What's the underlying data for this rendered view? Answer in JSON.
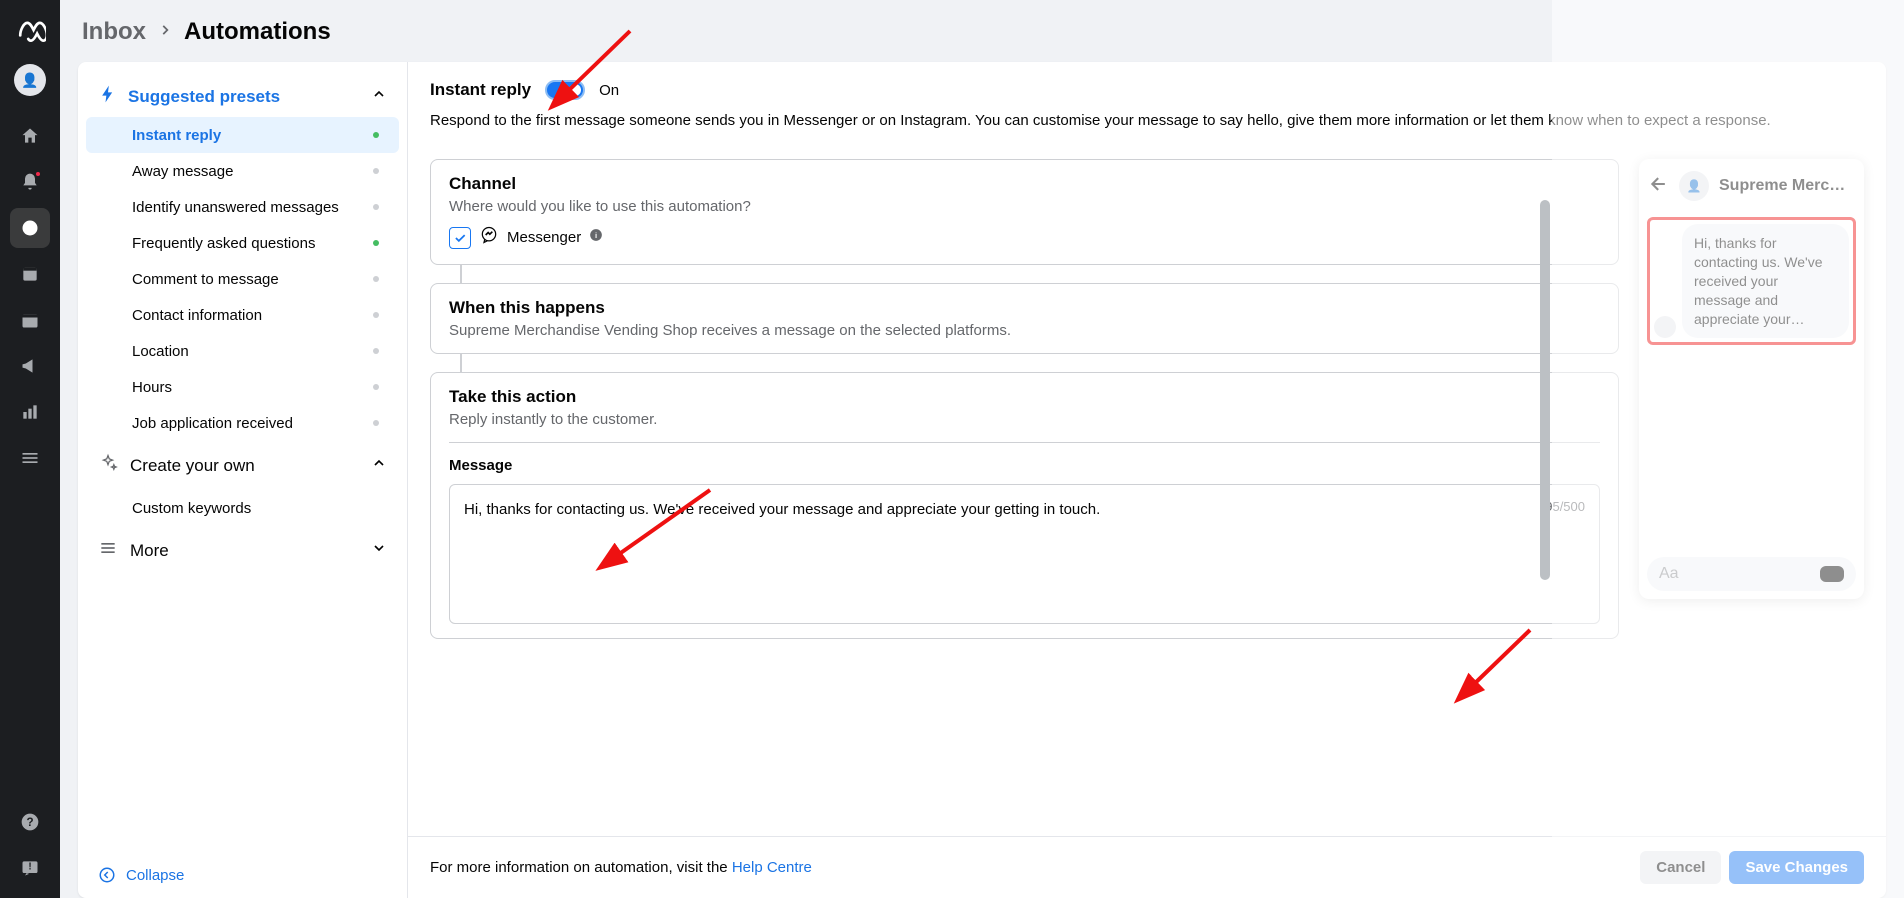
{
  "breadcrumb": {
    "parent": "Inbox",
    "current": "Automations"
  },
  "sidebar": {
    "suggested_title": "Suggested presets",
    "items": [
      {
        "label": "Instant reply",
        "active": true,
        "dot": "on"
      },
      {
        "label": "Away message",
        "dot": "off"
      },
      {
        "label": "Identify unanswered messages",
        "dot": "off"
      },
      {
        "label": "Frequently asked questions",
        "dot": "on"
      },
      {
        "label": "Comment to message",
        "dot": "off"
      },
      {
        "label": "Contact information",
        "dot": "off"
      },
      {
        "label": "Location",
        "dot": "off"
      },
      {
        "label": "Hours",
        "dot": "off"
      },
      {
        "label": "Job application received",
        "dot": "off"
      }
    ],
    "create_title": "Create your own",
    "custom_keywords": "Custom keywords",
    "more_title": "More",
    "collapse": "Collapse"
  },
  "header": {
    "title": "Instant reply",
    "toggle_state": "On",
    "desc": "Respond to the first message someone sends you in Messenger or on Instagram. You can customise your message to say hello, give them more information or let them know when to expect a response."
  },
  "cards": {
    "channel_title": "Channel",
    "channel_sub": "Where would you like to use this automation?",
    "channel_name": "Messenger",
    "when_title": "When this happens",
    "when_sub": "Supreme Merchandise Vending Shop receives a message on the selected platforms.",
    "action_title": "Take this action",
    "action_sub": "Reply instantly to the customer.",
    "message_label": "Message",
    "message_text": "Hi, thanks for contacting us. We've received your message and appreciate your getting in touch.",
    "message_count": "95/500"
  },
  "preview": {
    "name": "Supreme Merc…",
    "bubble": "Hi, thanks for contacting us. We've received your message and appreciate your…",
    "placeholder": "Aa"
  },
  "footer": {
    "info_prefix": "For more information on automation, visit the ",
    "info_link": "Help Centre",
    "cancel": "Cancel",
    "save": "Save Changes"
  }
}
